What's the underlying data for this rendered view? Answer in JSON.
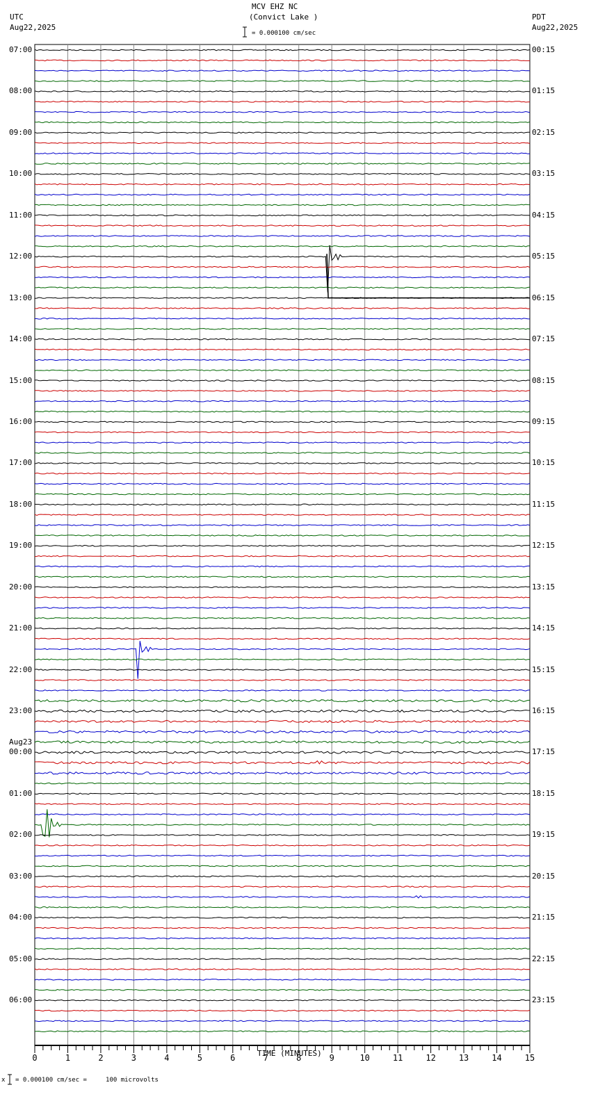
{
  "header": {
    "title": "MCV EHZ NC",
    "subtitle": "(Convict Lake )",
    "left_tz": "UTC",
    "left_date": "Aug22,2025",
    "right_tz": "PDT",
    "right_date": "Aug22,2025",
    "scale_text": "= 0.000100 cm/sec"
  },
  "footer": {
    "scale_text": "= 0.000100 cm/sec =     100 microvolts",
    "mark": "x"
  },
  "chart_data": {
    "type": "line",
    "title": "MCV EHZ NC (Convict Lake )",
    "xlabel": "TIME (MINUTES)",
    "xlim": [
      0,
      15
    ],
    "x_ticks": [
      "0",
      "1",
      "2",
      "3",
      "4",
      "5",
      "6",
      "7",
      "8",
      "9",
      "10",
      "11",
      "12",
      "13",
      "14",
      "15"
    ],
    "grid": true,
    "trace_count": 96,
    "trace_minutes": 15,
    "trace_colors": [
      "#000000",
      "#cc0000",
      "#0000cc",
      "#006600"
    ],
    "left_labels": [
      "07:00",
      "08:00",
      "09:00",
      "10:00",
      "11:00",
      "12:00",
      "13:00",
      "14:00",
      "15:00",
      "16:00",
      "17:00",
      "18:00",
      "19:00",
      "20:00",
      "21:00",
      "22:00",
      "23:00",
      "00:00",
      "01:00",
      "02:00",
      "03:00",
      "04:00",
      "05:00",
      "06:00"
    ],
    "left_date_change": "Aug23",
    "right_labels": [
      "00:15",
      "01:15",
      "02:15",
      "03:15",
      "04:15",
      "05:15",
      "06:15",
      "07:15",
      "08:15",
      "09:15",
      "10:15",
      "11:15",
      "12:15",
      "13:15",
      "14:15",
      "15:15",
      "16:15",
      "17:15",
      "18:15",
      "19:15",
      "20:15",
      "21:15",
      "22:15",
      "23:15"
    ],
    "events": [
      {
        "row": 20,
        "minute": 8.85,
        "amplitude_rows": 4.1,
        "note": "step offset, flat to end of row 24"
      },
      {
        "row": 58,
        "minute": 3.1,
        "amplitude_rows": 3.3
      },
      {
        "row": 75,
        "minute": 0.2,
        "amplitude_rows": 10
      },
      {
        "row": 69,
        "minute": 8.5,
        "amplitude_rows": 0.6
      },
      {
        "row": 82,
        "minute": 11.5,
        "amplitude_rows": 0.6
      }
    ]
  }
}
